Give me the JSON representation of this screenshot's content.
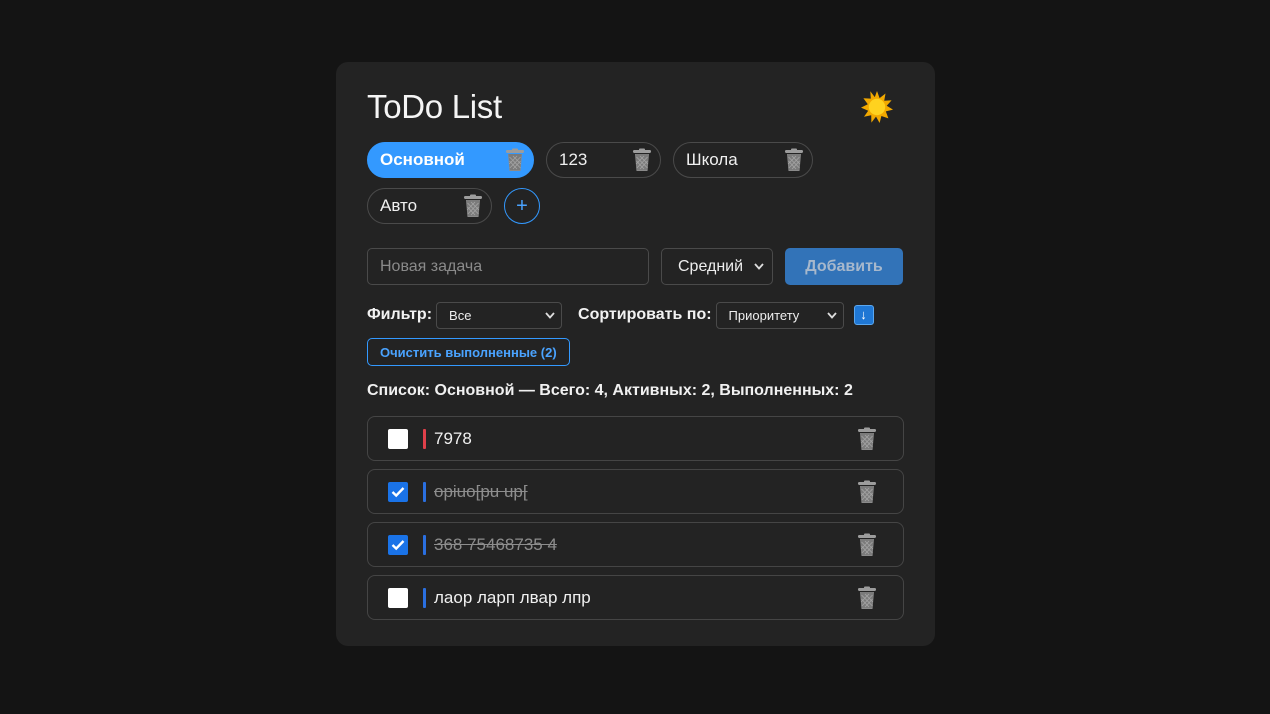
{
  "app": {
    "title": "ToDo List"
  },
  "theme_toggle": {
    "icon": "sun-icon"
  },
  "lists": [
    {
      "label": "Основной",
      "active": true
    },
    {
      "label": "123",
      "active": false
    },
    {
      "label": "Школа",
      "active": false
    },
    {
      "label": "Авто",
      "active": false
    }
  ],
  "add_list": {
    "label": "+"
  },
  "new_task": {
    "placeholder": "Новая задача",
    "value": "",
    "priority_selected": "Средний",
    "add_label": "Добавить"
  },
  "filter": {
    "label": "Фильтр:",
    "selected": "Все"
  },
  "sort": {
    "label": "Сортировать по:",
    "selected": "Приоритету",
    "direction_icon": "↓"
  },
  "clear_completed": {
    "label": "Очистить выполненные (2)"
  },
  "summary": "Список: Основной — Всего: 4, Активных: 2, Выполненных: 2",
  "colors": {
    "accent": "#3399ff",
    "priority_high": "#e0404a",
    "priority_medium": "#2a6fe0"
  },
  "tasks": [
    {
      "text": "7978",
      "done": false,
      "priority_color": "#e0404a"
    },
    {
      "text": "opiuo[pu up[",
      "done": true,
      "priority_color": "#2a6fe0"
    },
    {
      "text": "368 75468735 4",
      "done": true,
      "priority_color": "#2a6fe0"
    },
    {
      "text": "лаор ларп лвар лпр",
      "done": false,
      "priority_color": "#2a6fe0"
    }
  ]
}
